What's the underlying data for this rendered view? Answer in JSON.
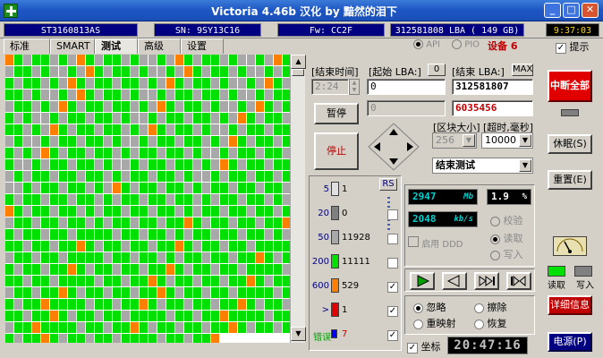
{
  "window": {
    "title": "Victoria 4.46b 汉化 by 黯然的泪下",
    "min": "_",
    "max": "□",
    "close": "✕"
  },
  "infobar": {
    "model": "ST3160813AS",
    "serial": "SN: 9SY13C16",
    "firmware": "Fw: CC2F",
    "lba": "312581808 LBA ( 149 GB)",
    "time": "9:37:03"
  },
  "tabs": [
    "标准",
    "SMART",
    "测试",
    "高级",
    "设置"
  ],
  "active_tab": "测试",
  "ports": {
    "api": "API",
    "pio": "PIO",
    "device": "设备 6",
    "hint": "提示"
  },
  "controls": {
    "end_time_label": "[结束时间]",
    "start_lba_label": "[起始 LBA:]",
    "start_lba_zero": "0",
    "end_lba_label": "[结束 LBA:]",
    "end_lba_max": "MAX",
    "end_time_value": "2:24",
    "start_lba_value": "0",
    "end_lba_value": "312581807",
    "pause_label": "暂停",
    "current_value": "0",
    "current_lba_value": "6035456",
    "stop_label": "停止",
    "block_size_label": "[区块大小]",
    "timeout_label": "[超时,毫秒]",
    "block_size_value": "256",
    "timeout_value": "10000",
    "end_action": "结束测试"
  },
  "legend": {
    "rs": "RS",
    "rows": [
      {
        "threshold": "5",
        "count": "1",
        "color": "#e0e0e0"
      },
      {
        "threshold": "20",
        "count": "0",
        "color": "#808080"
      },
      {
        "threshold": "50",
        "count": "11928",
        "color": "#a8a8a8"
      },
      {
        "threshold": "200",
        "count": "11111",
        "color": "#00e000"
      },
      {
        "threshold": "600",
        "count": "529",
        "color": "#ff8000"
      },
      {
        "threshold": ">",
        "count": "1",
        "color": "#e00000"
      },
      {
        "threshold": "错误",
        "count": "7",
        "color": "#0000ff"
      }
    ],
    "checks": [
      false,
      false,
      false,
      true,
      true,
      true
    ]
  },
  "stats": {
    "speed": "2947",
    "speed_unit": "Mb",
    "percent": "1.9",
    "percent_unit": "%",
    "rate": "2048",
    "rate_unit": "kb/s",
    "verify": "校验",
    "read": "读取",
    "write": "写入",
    "ddd": "启用 DDD"
  },
  "mode": {
    "ignore": "忽略",
    "erase": "擦除",
    "remap": "重映射",
    "restore": "恢复",
    "grid": "坐标",
    "clock": "20:47:16"
  },
  "side": {
    "break_all": "中断全部",
    "sleep": "休眠(S)",
    "reset": "重置(E)",
    "read": "读取",
    "write": "写入",
    "details": "详细信息",
    "power": "电源(P)"
  },
  "grid_cells": "OGGGGGGGGGGGGGGGGGGGGGGGGGGGGGGGGOGGGGGGGGGGGGGGGGGGGGGGGGGGGGGGGGGGGGGGGGGGGGGGGGGGGGGGGGGGGGGGGGGGGGGGGGGGGGGGGGGGGGGGGGGGGGGGGGGGGGGGGGGGGGGGGGGGGGGGGGGGGGGGGGGGGGGGGGGGGGGGGGGGGGGGGGGGGGGGGGGGGGGGGGGGGGGGGGGGGGGGGGGGGGGGGGGGGGGGGGGGGGGGGGGGGGGGGGGGGGGGGGGGGGGGGGGGGGGGGGGGGGGGGGGGGGGGGGGGGGGGGGGGGGGGGGGGGGGGGGGGGGGGGGGGGGGGGGGGGGGGGGGGGGGGGGGGGGGGGGGGGGGGGGGGGGGGGGGGGGGGGGGGGGGGGGGGGGGGGGGGGGGGGGGGGGGGGGGGGGGGGGGGGGGGGGGGGGGGGGGGGGGGGGGGGGGGGGGGGGGGGGGGGGGGGGGGGGGGGGGGGGGGGGGGGGGGGGGGGGGGGGGGGGGGGGGGGGGGGGGGGGGGGGGGGGGGGGGGGGGGGGGGGGGGGGGGGGGGGGGGGGGGGGGGGGGGGGGGGGGGGGGGGGGGGGGGGGGGGGGGGGGGGGGGGGGGGGGGGGGGGGGGGGGGGGGGGGGGGGGGGGGGGGGGGGGGGGGGGGGGGGGGGGGGGGGGGGGGGGGGGGGGGGGGGGGGGGGGGGGGGGGGGGGGGGGGGGGGGGGGGGGGGGGGGGGGGGGGGGGGGGGGGGG"
}
